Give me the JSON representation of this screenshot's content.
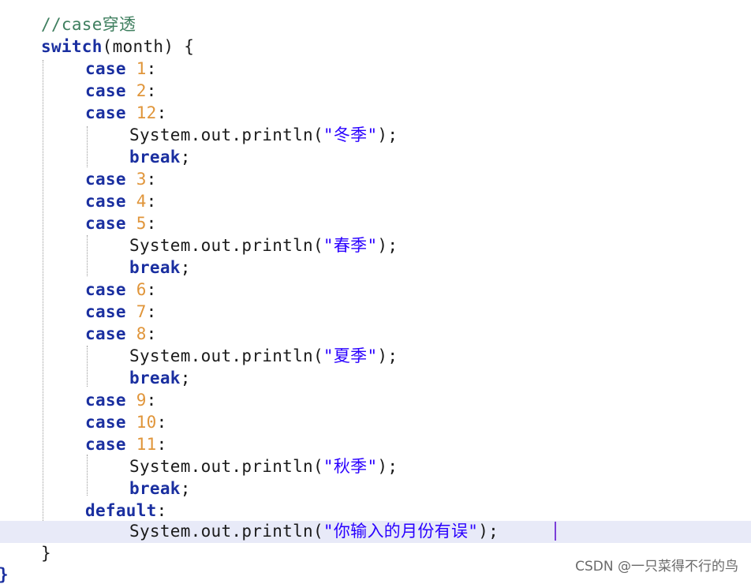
{
  "editor": {
    "lines": [
      {
        "tokens": [
          {
            "t": "//case穿透",
            "c": "comment"
          }
        ]
      },
      {
        "tokens": [
          {
            "t": "switch",
            "c": "kw"
          },
          {
            "t": "(month) {",
            "c": "plain"
          }
        ]
      },
      {
        "tokens": [
          {
            "t": "case ",
            "c": "kw"
          },
          {
            "t": "1",
            "c": "num"
          },
          {
            "t": ":",
            "c": "plain"
          }
        ]
      },
      {
        "tokens": [
          {
            "t": "case ",
            "c": "kw"
          },
          {
            "t": "2",
            "c": "num"
          },
          {
            "t": ":",
            "c": "plain"
          }
        ]
      },
      {
        "tokens": [
          {
            "t": "case ",
            "c": "kw"
          },
          {
            "t": "12",
            "c": "num"
          },
          {
            "t": ":",
            "c": "plain"
          }
        ]
      },
      {
        "tokens": [
          {
            "t": "System.out.println(",
            "c": "plain"
          },
          {
            "t": "\"冬季\"",
            "c": "str"
          },
          {
            "t": ");",
            "c": "plain"
          }
        ]
      },
      {
        "tokens": [
          {
            "t": "break",
            "c": "kw"
          },
          {
            "t": ";",
            "c": "plain"
          }
        ]
      },
      {
        "tokens": [
          {
            "t": "case ",
            "c": "kw"
          },
          {
            "t": "3",
            "c": "num"
          },
          {
            "t": ":",
            "c": "plain"
          }
        ]
      },
      {
        "tokens": [
          {
            "t": "case ",
            "c": "kw"
          },
          {
            "t": "4",
            "c": "num"
          },
          {
            "t": ":",
            "c": "plain"
          }
        ]
      },
      {
        "tokens": [
          {
            "t": "case ",
            "c": "kw"
          },
          {
            "t": "5",
            "c": "num"
          },
          {
            "t": ":",
            "c": "plain"
          }
        ]
      },
      {
        "tokens": [
          {
            "t": "System.out.println(",
            "c": "plain"
          },
          {
            "t": "\"春季\"",
            "c": "str"
          },
          {
            "t": ");",
            "c": "plain"
          }
        ]
      },
      {
        "tokens": [
          {
            "t": "break",
            "c": "kw"
          },
          {
            "t": ";",
            "c": "plain"
          }
        ]
      },
      {
        "tokens": [
          {
            "t": "case ",
            "c": "kw"
          },
          {
            "t": "6",
            "c": "num"
          },
          {
            "t": ":",
            "c": "plain"
          }
        ]
      },
      {
        "tokens": [
          {
            "t": "case ",
            "c": "kw"
          },
          {
            "t": "7",
            "c": "num"
          },
          {
            "t": ":",
            "c": "plain"
          }
        ]
      },
      {
        "tokens": [
          {
            "t": "case ",
            "c": "kw"
          },
          {
            "t": "8",
            "c": "num"
          },
          {
            "t": ":",
            "c": "plain"
          }
        ]
      },
      {
        "tokens": [
          {
            "t": "System.out.println(",
            "c": "plain"
          },
          {
            "t": "\"夏季\"",
            "c": "str"
          },
          {
            "t": ");",
            "c": "plain"
          }
        ]
      },
      {
        "tokens": [
          {
            "t": "break",
            "c": "kw"
          },
          {
            "t": ";",
            "c": "plain"
          }
        ]
      },
      {
        "tokens": [
          {
            "t": "case ",
            "c": "kw"
          },
          {
            "t": "9",
            "c": "num"
          },
          {
            "t": ":",
            "c": "plain"
          }
        ]
      },
      {
        "tokens": [
          {
            "t": "case ",
            "c": "kw"
          },
          {
            "t": "10",
            "c": "num"
          },
          {
            "t": ":",
            "c": "plain"
          }
        ]
      },
      {
        "tokens": [
          {
            "t": "case ",
            "c": "kw"
          },
          {
            "t": "11",
            "c": "num"
          },
          {
            "t": ":",
            "c": "plain"
          }
        ]
      },
      {
        "tokens": [
          {
            "t": "System.out.println(",
            "c": "plain"
          },
          {
            "t": "\"秋季\"",
            "c": "str"
          },
          {
            "t": ");",
            "c": "plain"
          }
        ]
      },
      {
        "tokens": [
          {
            "t": "break",
            "c": "kw"
          },
          {
            "t": ";",
            "c": "plain"
          }
        ]
      },
      {
        "tokens": [
          {
            "t": "default",
            "c": "kw"
          },
          {
            "t": ":",
            "c": "plain"
          }
        ]
      },
      {
        "tokens": [
          {
            "t": "System.out.println(",
            "c": "plain"
          },
          {
            "t": "\"你输入的月份有误\"",
            "c": "str"
          },
          {
            "t": ");",
            "c": "plain"
          }
        ],
        "current": true
      },
      {
        "tokens": [
          {
            "t": "}",
            "c": "plain"
          }
        ]
      }
    ],
    "outer_brace": "}"
  },
  "watermark": "CSDN @一只菜得不行的鸟"
}
